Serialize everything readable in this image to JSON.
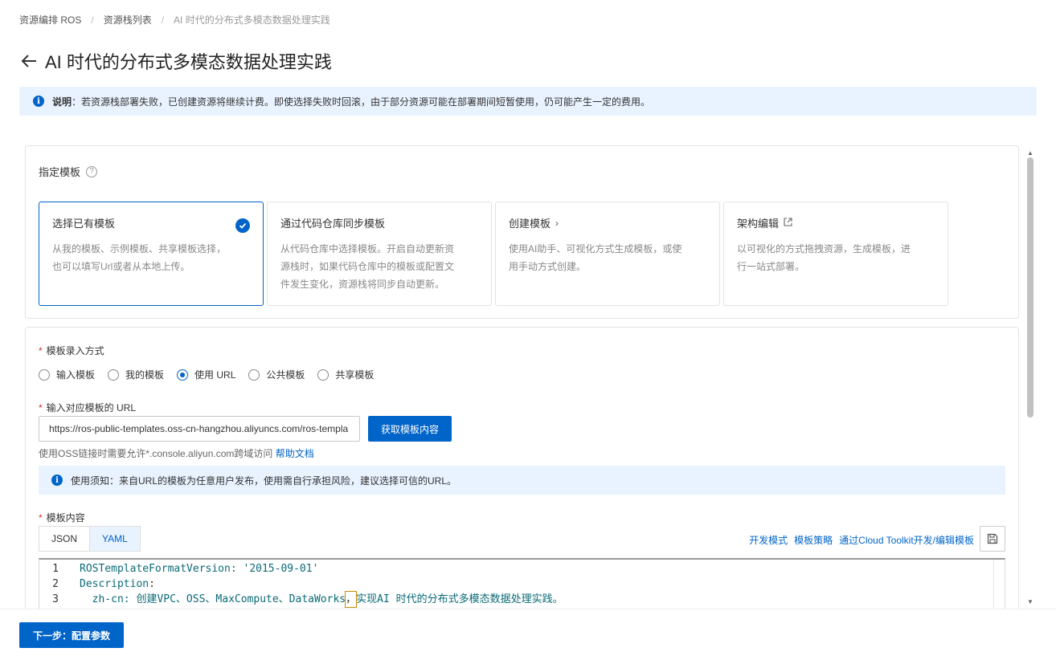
{
  "breadcrumb": [
    "资源编排 ROS",
    "资源栈列表",
    "AI 时代的分布式多模态数据处理实践"
  ],
  "page_title": "AI 时代的分布式多模态数据处理实践",
  "notice": {
    "bold": "说明",
    "text": "：若资源栈部署失败，已创建资源将继续计费。即使选择失败时回滚，由于部分资源可能在部署期间短暂使用，仍可能产生一定的费用。"
  },
  "template_section": {
    "label": "指定模板",
    "cards": [
      {
        "title": "选择已有模板",
        "desc": "从我的模板、示例模板、共享模板选择，也可以填写Url或者从本地上传。",
        "selected": true
      },
      {
        "title": "通过代码仓库同步模板",
        "desc": "从代码仓库中选择模板。开启自动更新资源栈时，如果代码仓库中的模板或配置文件发生变化，资源栈将同步自动更新。"
      },
      {
        "title": "创建模板",
        "suffix": "›",
        "desc": "使用AI助手、可视化方式生成模板，或使用手动方式创建。"
      },
      {
        "title": "架构编辑",
        "desc": "以可视化的方式拖拽资源，生成模板，进行一站式部署。"
      }
    ]
  },
  "input_method": {
    "label": "模板录入方式",
    "options": [
      "输入模板",
      "我的模板",
      "使用 URL",
      "公共模板",
      "共享模板"
    ],
    "selected": "使用 URL"
  },
  "url_field": {
    "label": "输入对应模板的 URL",
    "value": "https://ros-public-templates.oss-cn-hangzhou.aliyuncs.com/ros-templa",
    "button": "获取模板内容",
    "hint": "使用OSS链接时需要允许*.console.aliyun.com跨域访问 ",
    "hint_link": "帮助文档"
  },
  "url_notice": "使用须知：来自URL的模板为任意用户发布，使用需自行承担风险，建议选择可信的URL。",
  "template_content": {
    "label": "模板内容",
    "tabs": [
      "JSON",
      "YAML"
    ],
    "active_tab": "YAML",
    "links": [
      "开发模式",
      "模板策略",
      "通过Cloud Toolkit开发/编辑模板"
    ],
    "code": [
      {
        "n": "1",
        "key": "ROSTemplateFormatVersion",
        "rest": ": '2015-09-01'"
      },
      {
        "n": "2",
        "key": "Description",
        "rest": ":"
      },
      {
        "n": "3",
        "key": "  zh-cn",
        "pre": ": 创建VPC、OSS、MaxCompute、DataWorks",
        "cur": "，",
        "post": "实现AI 时代的分布式多模态数据处理实践。"
      }
    ]
  },
  "footer": {
    "next_button": "下一步：配置参数"
  },
  "colors": {
    "primary": "#0064c8",
    "notice_bg": "#e9f3ff",
    "required": "#d93026"
  }
}
